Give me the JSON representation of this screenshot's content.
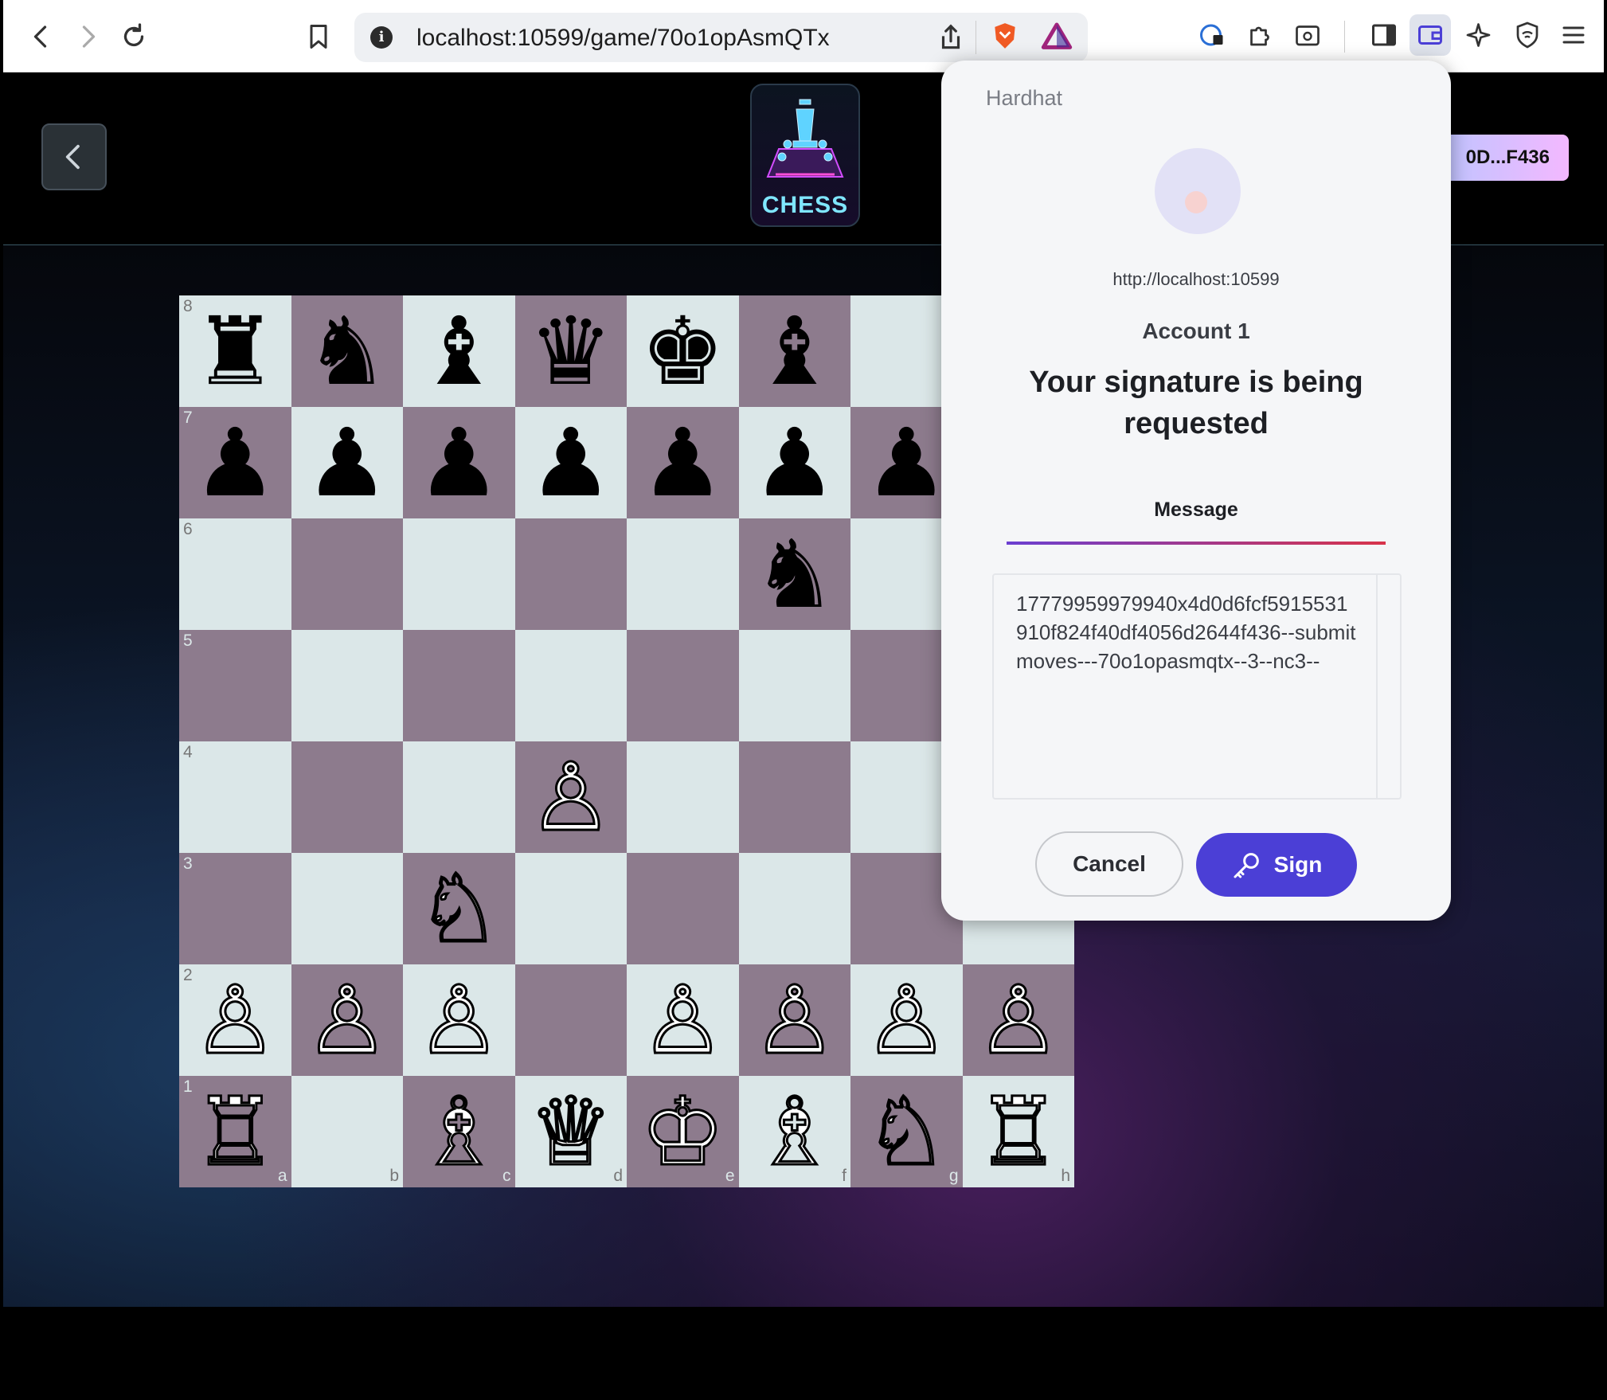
{
  "browser": {
    "url": "localhost:10599/game/70o1opAsmQTx"
  },
  "app": {
    "logo_text": "CHESS",
    "account_short": "0D...F436"
  },
  "board": {
    "files": [
      "a",
      "b",
      "c",
      "d",
      "e",
      "f",
      "g",
      "h"
    ],
    "ranks": [
      "8",
      "7",
      "6",
      "5",
      "4",
      "3",
      "2",
      "1"
    ],
    "rows": [
      [
        "♜",
        "♞",
        "♝",
        "♛",
        "♚",
        "♝",
        "",
        ""
      ],
      [
        "♟",
        "♟",
        "♟",
        "♟",
        "♟",
        "♟",
        "♟",
        ""
      ],
      [
        "",
        "",
        "",
        "",
        "",
        "♞",
        "",
        ""
      ],
      [
        "",
        "",
        "",
        "",
        "",
        "",
        "",
        ""
      ],
      [
        "",
        "",
        "",
        "♙",
        "",
        "",
        "",
        ""
      ],
      [
        "",
        "",
        "♘",
        "",
        "",
        "",
        "",
        ""
      ],
      [
        "♙",
        "♙",
        "♙",
        "",
        "♙",
        "♙",
        "♙",
        "♙"
      ],
      [
        "♖",
        "",
        "♗",
        "♕",
        "♔",
        "♗",
        "♘",
        "♖"
      ]
    ]
  },
  "popup": {
    "brand": "Hardhat",
    "origin": "http://localhost:10599",
    "account": "Account 1",
    "title": "Your signature is being requested",
    "tab": "Message",
    "message": "17779959979940x4d0d6fcf5915531910f824f40df4056d2644f436--submitmoves---70o1opasmqtx--3--nc3--",
    "cancel_label": "Cancel",
    "sign_label": "Sign"
  }
}
